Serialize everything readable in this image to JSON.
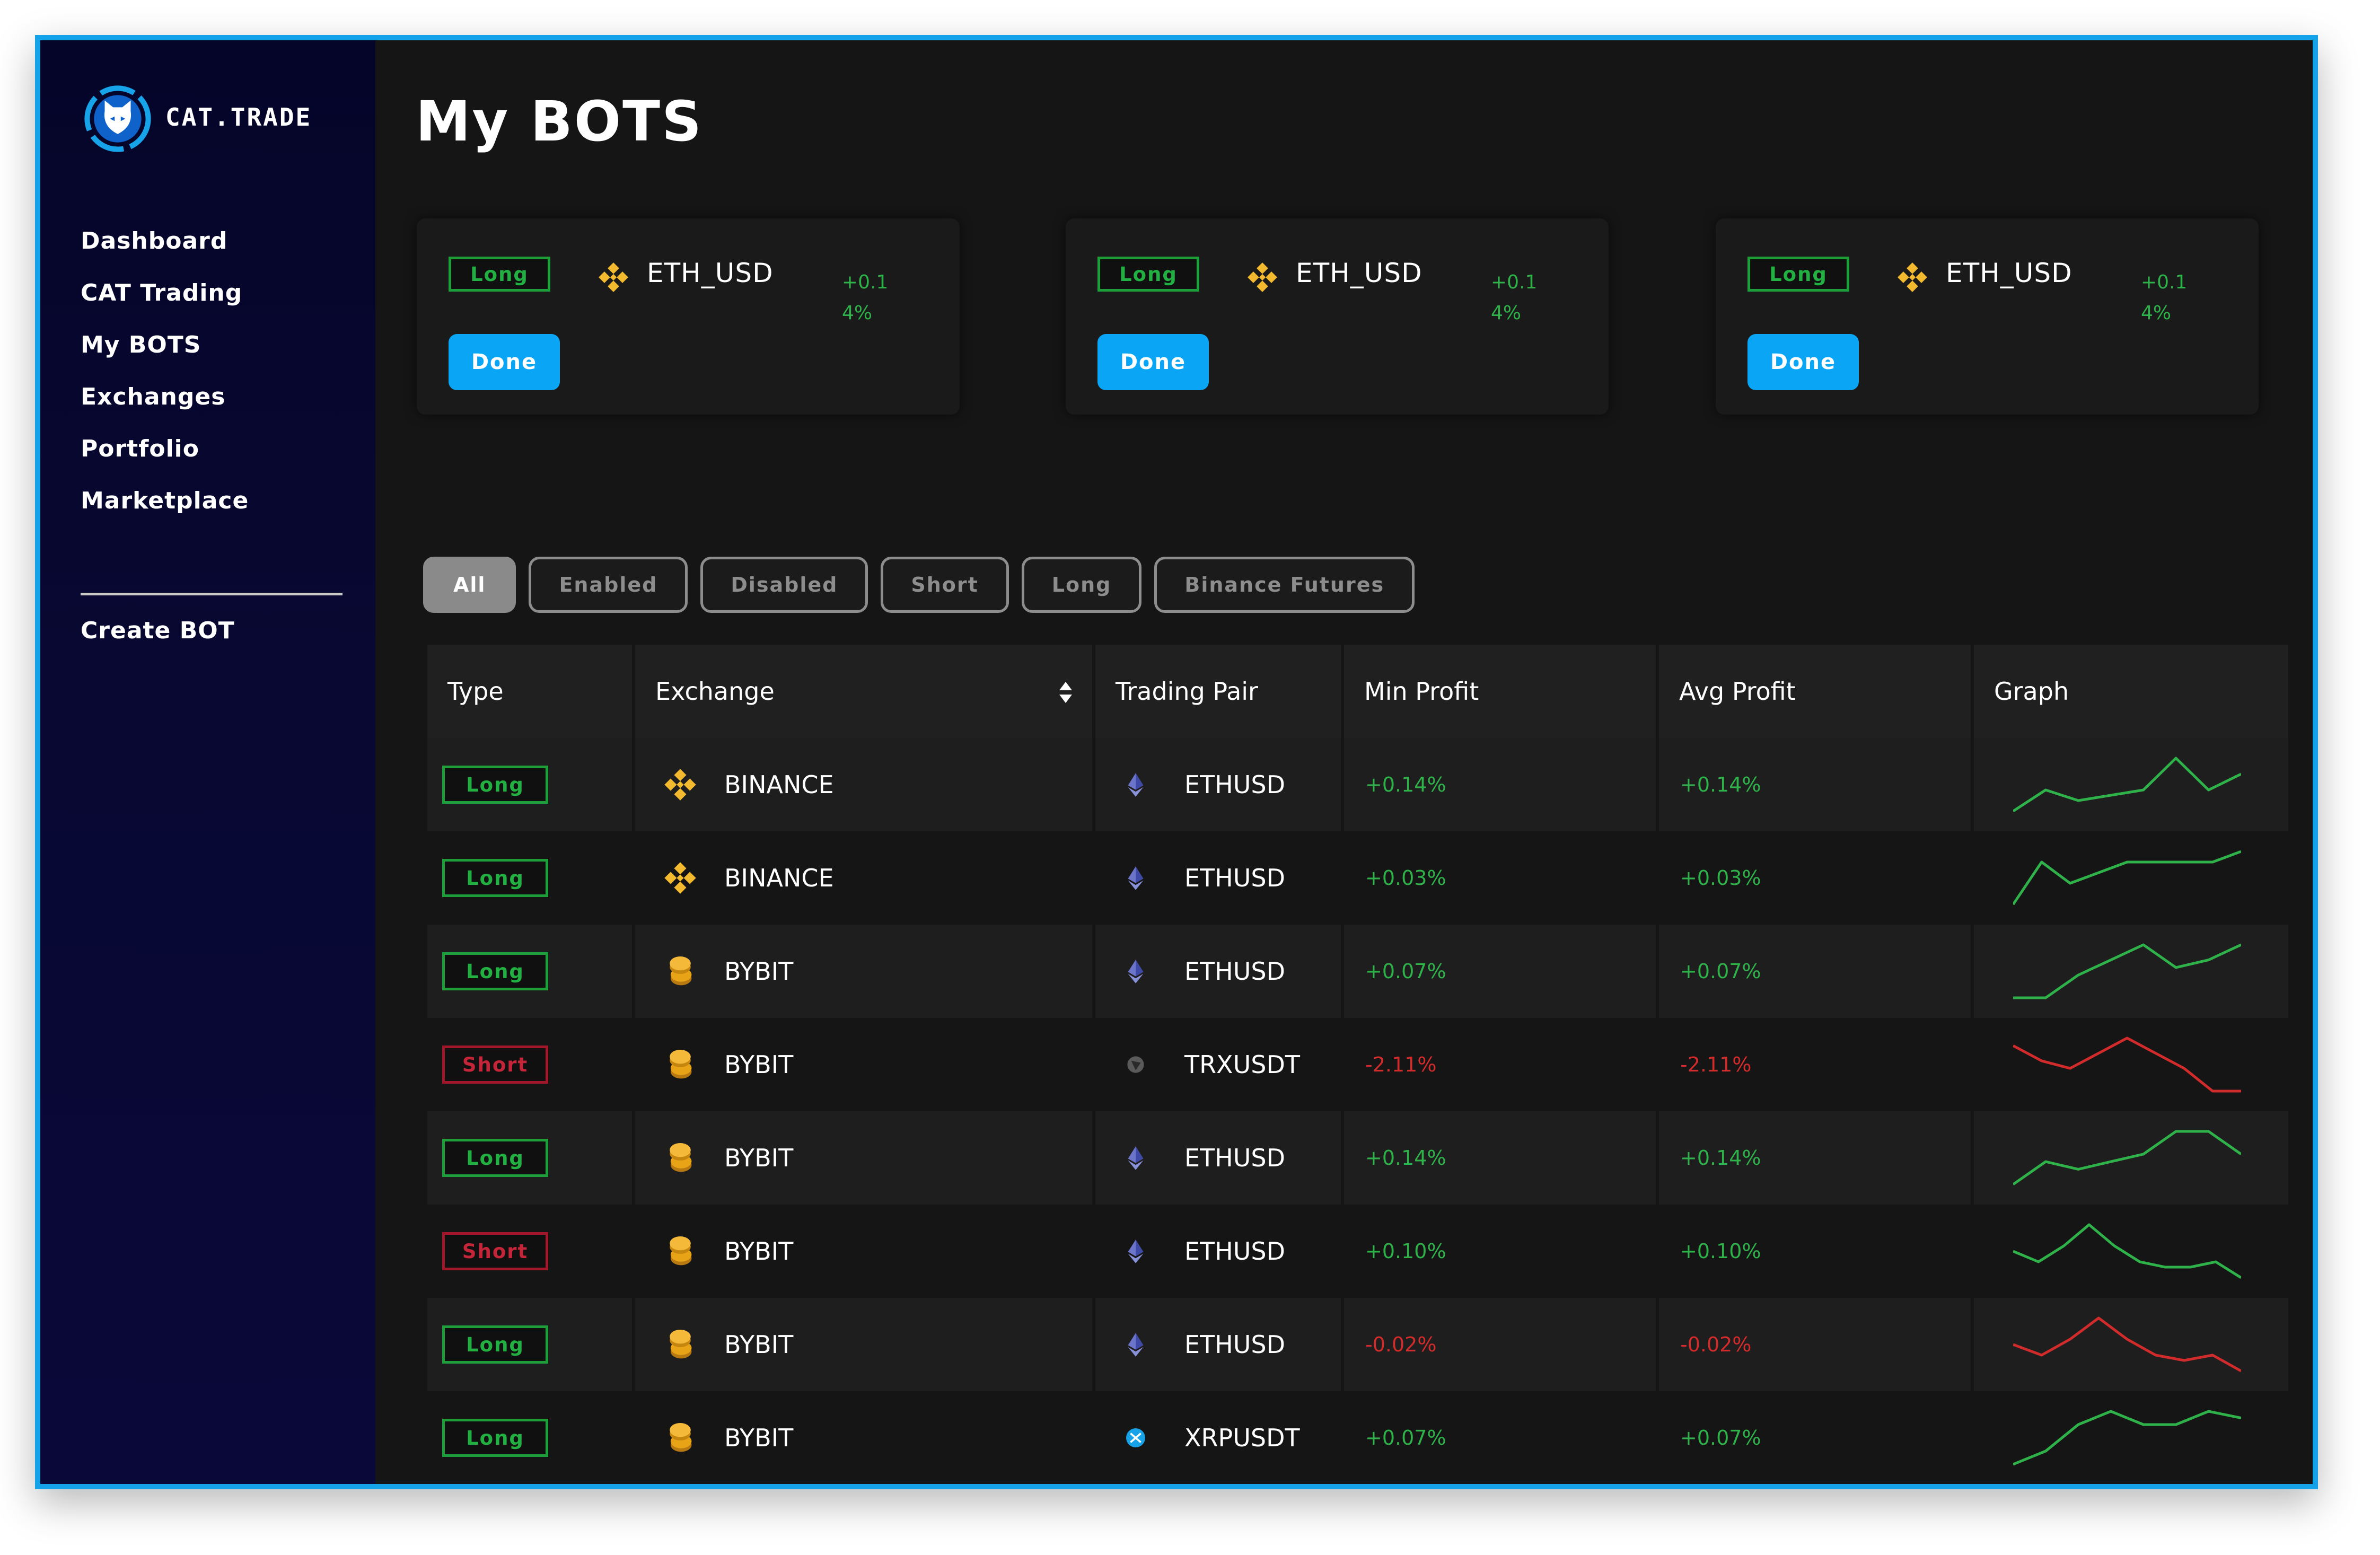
{
  "brand": {
    "name": "CAT.TRADE",
    "accent": "#14a3e8"
  },
  "sidebar": {
    "items": [
      {
        "label": "Dashboard"
      },
      {
        "label": "CAT Trading"
      },
      {
        "label": "My BOTS"
      },
      {
        "label": "Exchanges"
      },
      {
        "label": "Portfolio"
      },
      {
        "label": "Marketplace"
      }
    ],
    "create_label": "Create BOT"
  },
  "page": {
    "title": "My BOTS"
  },
  "cards": [
    {
      "type": "Long",
      "exchange_icon": "binance-icon",
      "pair": "ETH_USD",
      "profit": "+0.14%",
      "button": "Done"
    },
    {
      "type": "Long",
      "exchange_icon": "binance-icon",
      "pair": "ETH_USD",
      "profit": "+0.14%",
      "button": "Done"
    },
    {
      "type": "Long",
      "exchange_icon": "binance-icon",
      "pair": "ETH_USD",
      "profit": "+0.14%",
      "button": "Done"
    }
  ],
  "filters": [
    {
      "label": "All",
      "active": true
    },
    {
      "label": "Enabled"
    },
    {
      "label": "Disabled"
    },
    {
      "label": "Short"
    },
    {
      "label": "Long"
    },
    {
      "label": "Binance Futures"
    }
  ],
  "table": {
    "headers": [
      "Type",
      "Exchange",
      "Trading Pair",
      "Min Profit",
      "Avg Profit",
      "Graph"
    ],
    "rows": [
      {
        "type": "Long",
        "exchange": "BINANCE",
        "exchange_icon": "binance-icon",
        "pair": "ETHUSD",
        "pair_icon": "ethereum-icon",
        "min": "+0.14%",
        "avg": "+0.14%",
        "trend": "up",
        "graph": [
          2,
          6,
          4,
          5,
          6,
          12,
          6,
          9
        ]
      },
      {
        "type": "Long",
        "exchange": "BINANCE",
        "exchange_icon": "binance-icon",
        "pair": "ETHUSD",
        "pair_icon": "ethereum-icon",
        "min": "+0.03%",
        "avg": "+0.03%",
        "trend": "up",
        "graph": [
          2,
          6,
          4,
          5,
          6,
          6,
          6,
          6,
          7
        ]
      },
      {
        "type": "Long",
        "exchange": "BYBIT",
        "exchange_icon": "bybit-icon",
        "pair": "ETHUSD",
        "pair_icon": "ethereum-icon",
        "min": "+0.07%",
        "avg": "+0.07%",
        "trend": "up",
        "graph": [
          2,
          2,
          5,
          7,
          9,
          6,
          7,
          9
        ]
      },
      {
        "type": "Short",
        "exchange": "BYBIT",
        "exchange_icon": "bybit-icon",
        "pair": "TRXUSDT",
        "pair_icon": "tron-icon",
        "min": "-2.11%",
        "avg": "-2.11%",
        "trend": "down",
        "graph": [
          9,
          7,
          6,
          8,
          10,
          8,
          6,
          3,
          3
        ]
      },
      {
        "type": "Long",
        "exchange": "BYBIT",
        "exchange_icon": "bybit-icon",
        "pair": "ETHUSD",
        "pair_icon": "ethereum-icon",
        "min": "+0.14%",
        "avg": "+0.14%",
        "trend": "up",
        "graph": [
          3,
          6,
          5,
          6,
          7,
          10,
          10,
          7
        ]
      },
      {
        "type": "Short",
        "exchange": "BYBIT",
        "exchange_icon": "bybit-icon",
        "pair": "ETHUSD",
        "pair_icon": "ethereum-icon",
        "min": "+0.10%",
        "avg": "+0.10%",
        "trend": "up",
        "graph": [
          7,
          5,
          8,
          12,
          8,
          5,
          4,
          4,
          5,
          2
        ]
      },
      {
        "type": "Long",
        "exchange": "BYBIT",
        "exchange_icon": "bybit-icon",
        "pair": "ETHUSD",
        "pair_icon": "ethereum-icon",
        "min": "-0.02%",
        "avg": "-0.02%",
        "trend": "down",
        "graph": [
          7,
          5,
          8,
          12,
          8,
          5,
          4,
          5,
          2
        ]
      },
      {
        "type": "Long",
        "exchange": "BYBIT",
        "exchange_icon": "bybit-icon",
        "pair": "XRPUSDT",
        "pair_icon": "xrp-icon",
        "min": "+0.07%",
        "avg": "+0.07%",
        "trend": "up",
        "graph": [
          2,
          4,
          8,
          10,
          8,
          8,
          10,
          9
        ]
      }
    ]
  },
  "colors": {
    "positive": "#2fb24a",
    "negative": "#d22b2b",
    "button": "#0aa6f5",
    "binance": "#f3ba2f",
    "bybit": "#e8a317"
  }
}
